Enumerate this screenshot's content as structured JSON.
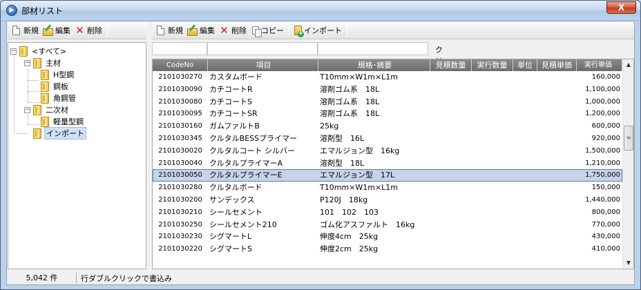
{
  "window": {
    "title": "部材リスト",
    "close_label": "X"
  },
  "left_toolbar": {
    "new": "新規",
    "edit": "編集",
    "delete": "削除"
  },
  "right_toolbar": {
    "new": "新規",
    "edit": "編集",
    "delete": "削除",
    "copy": "コピー",
    "import": "インポート"
  },
  "tree": {
    "root": "<すべて>",
    "main": "主材",
    "main_children": [
      "H型鋼",
      "鋼板",
      "角鋼管"
    ],
    "secondary": "二次材",
    "secondary_children": [
      "軽量型鋼"
    ],
    "import": "インポート"
  },
  "filter": {
    "clear_label": "クリア(",
    "clear_key": "C",
    "clear_close": ")"
  },
  "grid": {
    "columns": [
      "CodeNo",
      "項目",
      "規格･摘要",
      "見積数量",
      "実行数量",
      "単位",
      "見積単価",
      "実行単価"
    ],
    "rows": [
      {
        "code": "2101030270",
        "item": "カスタムボード",
        "spec": "T10mm×W1m×L1m",
        "price": "160,000"
      },
      {
        "code": "2101030090",
        "item": "カチコートR",
        "spec": "溶剤ゴム系　18L",
        "price": "1,100,000"
      },
      {
        "code": "2101030080",
        "item": "カチコートS",
        "spec": "溶剤ゴム系　18L",
        "price": "1,000,000"
      },
      {
        "code": "2101030095",
        "item": "カチコートSR",
        "spec": "溶剤ゴム系　18L",
        "price": "1,200,000"
      },
      {
        "code": "2101030160",
        "item": "ガムファルトB",
        "spec": "25kg",
        "price": "600,000"
      },
      {
        "code": "2101030345",
        "item": "クルタルBESSプライマー",
        "spec": "溶剤型　16L",
        "price": "920,000"
      },
      {
        "code": "2101030020",
        "item": "クルタルコート シルバー",
        "spec": "エマルジョン型　16kg",
        "price": "1,500,000"
      },
      {
        "code": "2101030040",
        "item": "クルタルプライマーA",
        "spec": "溶剤型　18L",
        "price": "1,210,000"
      },
      {
        "code": "2101030050",
        "item": "クルタルプライマーE",
        "spec": "エマルジョン型　17L",
        "price": "1,750,000"
      },
      {
        "code": "2101030280",
        "item": "クルタルボード",
        "spec": "T10mm×W1m×L1m",
        "price": "150,000"
      },
      {
        "code": "2101030200",
        "item": "サンデックス",
        "spec": "P120J　18kg",
        "price": "1,440,000"
      },
      {
        "code": "2101030210",
        "item": "シールセメント",
        "spec": "101　102　103",
        "price": "800,000"
      },
      {
        "code": "2101030250",
        "item": "シールセメント210",
        "spec": "ゴム化アスファルト　16kg",
        "price": "770,000"
      },
      {
        "code": "2101030230",
        "item": "シグマートL",
        "spec": "伸度4cm　25kg",
        "price": "430,000"
      },
      {
        "code": "2101030220",
        "item": "シグマートS",
        "spec": "伸度2cm　25kg",
        "price": "410,000"
      }
    ],
    "selected_row": 8
  },
  "status": {
    "count": "5,042 件",
    "hint": "行ダブルクリックで書込み"
  }
}
